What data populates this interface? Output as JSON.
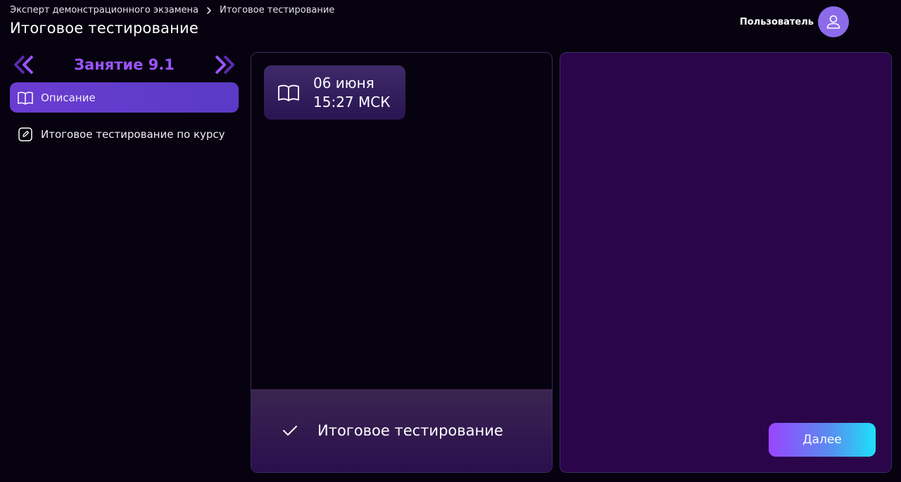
{
  "header": {
    "breadcrumb": [
      "Эксперт демонстрационного экзамена",
      "Итоговое тестирование"
    ],
    "title": "Итоговое тестирование",
    "user_name": "Пользователь"
  },
  "sidebar": {
    "lesson_title": "Занятие 9.1",
    "items": [
      {
        "label": "Описание",
        "icon": "book-icon",
        "active": true
      },
      {
        "label": "Итоговое тестирование по курсу",
        "icon": "edit-icon",
        "active": false
      }
    ]
  },
  "content": {
    "date_line": "06 июня",
    "time_line": "15:27 МСК",
    "test_label": "Итоговое тестирование"
  },
  "actions": {
    "next_label": "Далее"
  },
  "colors": {
    "accent": "#9a55ff",
    "active_item": "#6a3dd1",
    "panel_right": "#2a0549",
    "avatar": "#8c6bea"
  }
}
